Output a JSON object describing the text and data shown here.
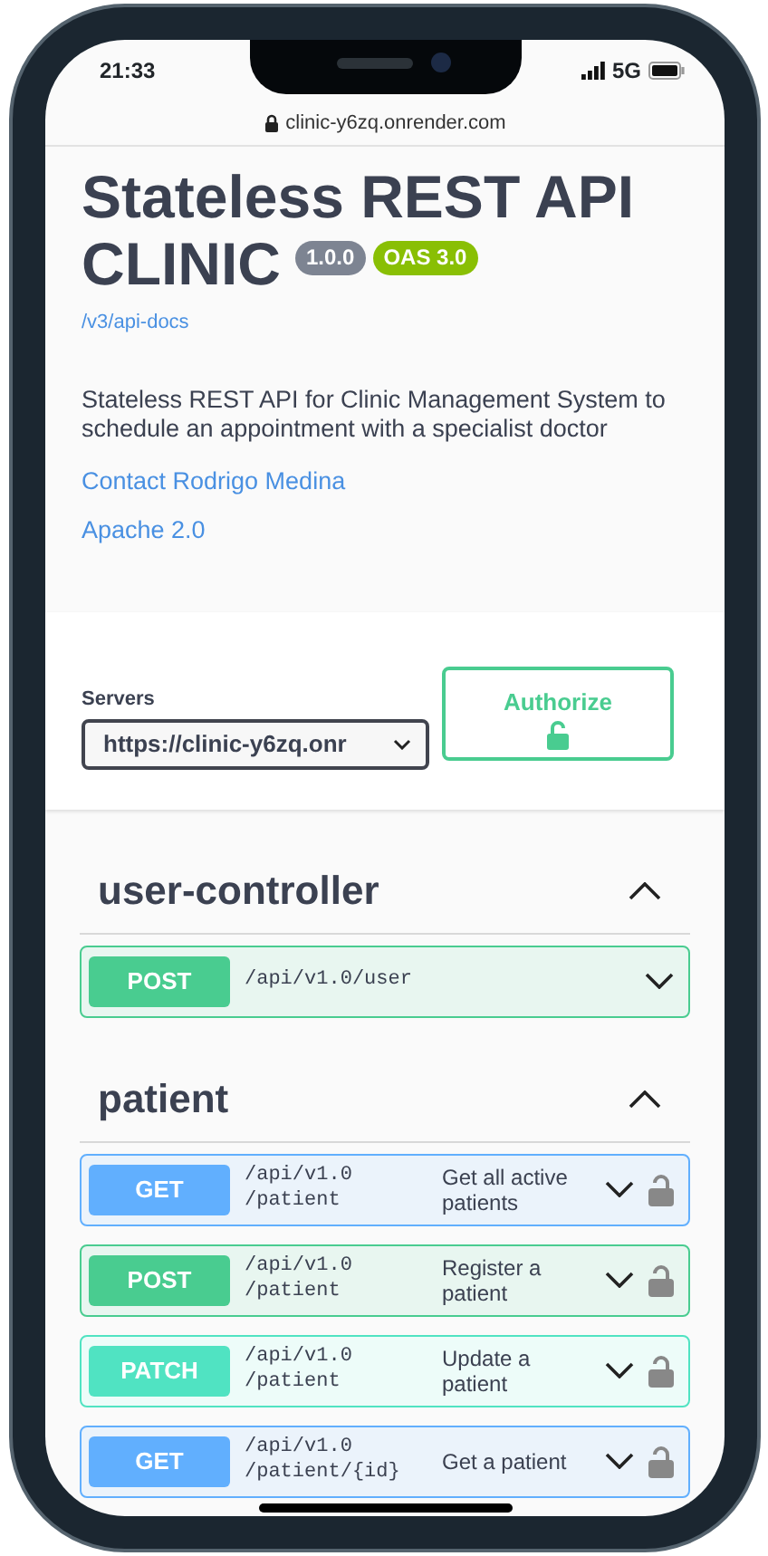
{
  "status_bar": {
    "time": "21:33",
    "network": "5G"
  },
  "address_bar": {
    "url": "clinic-y6zq.onrender.com",
    "secure": true
  },
  "info": {
    "title_lines": [
      "Stateless REST API",
      "CLINIC"
    ],
    "version": "1.0.0",
    "oas": "OAS 3.0",
    "spec_link": "/v3/api-docs",
    "description": "Stateless REST API for Clinic Management System to schedule an appointment with a specialist doctor",
    "links": [
      "Contact Rodrigo Medina",
      "Apache 2.0"
    ]
  },
  "servers": {
    "label": "Servers",
    "value": "https://clinic-y6zq.onr"
  },
  "authorize": {
    "label": "Authorize"
  },
  "sections": [
    {
      "name": "user-controller",
      "expanded": true,
      "operations": [
        {
          "method": "POST",
          "path": "/api/v1.0/user",
          "secured": false
        }
      ]
    },
    {
      "name": "patient",
      "expanded": true,
      "operations": [
        {
          "method": "GET",
          "path": "/api/v1.0/patient",
          "summary": "Get all active patients",
          "secured": true
        },
        {
          "method": "POST",
          "path": "/api/v1.0/patient",
          "summary": "Register a patient",
          "secured": true
        },
        {
          "method": "PATCH",
          "path": "/api/v1.0/patient",
          "summary": "Update a patient",
          "secured": true
        },
        {
          "method": "GET",
          "path": "/api/v1.0/patient/{id}",
          "summary": "Get a patient",
          "secured": true
        }
      ]
    }
  ]
}
